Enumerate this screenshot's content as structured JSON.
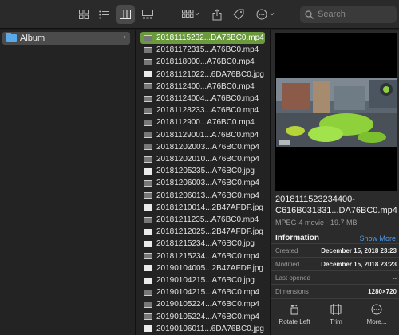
{
  "search": {
    "placeholder": "Search"
  },
  "sidebar": {
    "album_label": "Album"
  },
  "files": [
    "20181115232...DA76BC0.mp4",
    "20181172315...A76BC0.mp4",
    "2018118000...A76BC0.mp4",
    "20181121022...6DA76BC0.jpg",
    "2018112400...A76BC0.mp4",
    "20181124004...A76BC0.mp4",
    "20181128233...A76BC0.mp4",
    "2018112900...A76BC0.mp4",
    "20181129001...A76BC0.mp4",
    "20181202003...A76BC0.mp4",
    "20181202010...A76BC0.mp4",
    "20181205235...A76BC0.jpg",
    "20181206003...A76BC0.mp4",
    "20181206013...A76BC0.mp4",
    "20181210014...2B47AFDF.jpg",
    "20181211235...A76BC0.mp4",
    "20181212025...2B47AFDF.jpg",
    "20181215234...A76BC0.jpg",
    "20181215234...A76BC0.mp4",
    "20190104005...2B47AFDF.jpg",
    "20190104215...A76BC0.jpg",
    "20190104215...A76BC0.mp4",
    "20190105224...A76BC0.mp4",
    "20190105224...A76BC0.mp4",
    "20190106011...6DA76BC0.jpg"
  ],
  "selected_index": 0,
  "preview": {
    "file_title": "2018111523234400-C616B031331...DA76BC0.mp4",
    "file_sub": "MPEG-4 movie - 19.7 MB",
    "info_header": "Information",
    "show_more": "Show More",
    "rows": [
      {
        "key": "Created",
        "value": "December 15, 2018 23:23"
      },
      {
        "key": "Modified",
        "value": "December 15, 2018 23:23"
      },
      {
        "key": "Last opened",
        "value": "--"
      },
      {
        "key": "Dimensions",
        "value": "1280×720"
      }
    ],
    "actions": [
      {
        "label": "Rotate Left",
        "icon": "rotate-left-icon"
      },
      {
        "label": "Trim",
        "icon": "trim-icon"
      },
      {
        "label": "More...",
        "icon": "more-icon"
      }
    ]
  },
  "colors": {
    "selection": "#6a9a3d",
    "accent": "#4b9cf0",
    "folder": "#5aa9e8"
  }
}
